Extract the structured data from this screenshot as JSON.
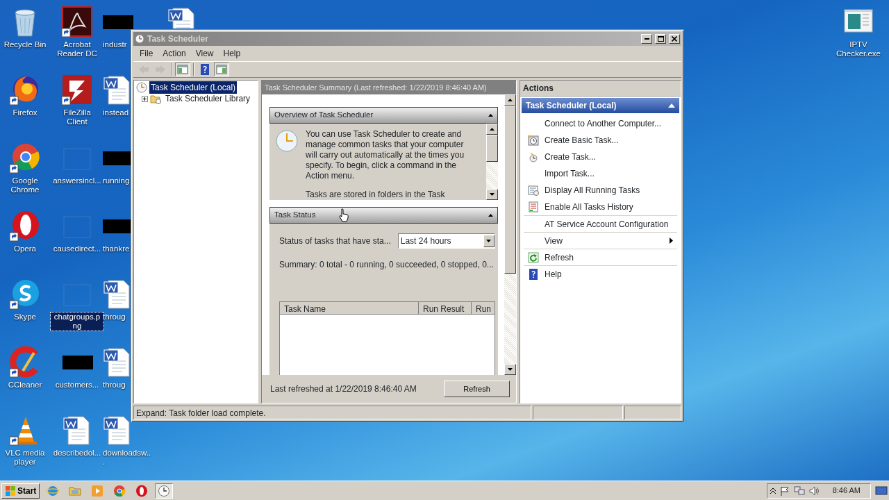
{
  "desktop_icons": [
    {
      "label": "Recycle Bin",
      "kind": "recycle",
      "shortcut": false,
      "selected": false
    },
    {
      "label": "Firefox",
      "kind": "firefox",
      "shortcut": true,
      "selected": false
    },
    {
      "label": "Google Chrome",
      "kind": "chrome",
      "shortcut": true,
      "selected": false
    },
    {
      "label": "Opera",
      "kind": "opera",
      "shortcut": true,
      "selected": false
    },
    {
      "label": "Skype",
      "kind": "skype",
      "shortcut": true,
      "selected": false
    },
    {
      "label": "CCleaner",
      "kind": "ccleaner",
      "shortcut": true,
      "selected": false
    },
    {
      "label": "VLC media player",
      "kind": "vlc",
      "shortcut": true,
      "selected": false
    },
    {
      "label": "Acrobat Reader DC",
      "kind": "acrobat",
      "shortcut": true,
      "selected": false
    },
    {
      "label": "FileZilla Client",
      "kind": "filezilla",
      "shortcut": true,
      "selected": false
    },
    {
      "label": "answersincl...",
      "kind": "blank",
      "shortcut": false,
      "selected": false
    },
    {
      "label": "causedirect...",
      "kind": "blank",
      "shortcut": false,
      "selected": false
    },
    {
      "label": "chatgroups.png",
      "kind": "blank",
      "shortcut": false,
      "selected": true
    },
    {
      "label": "customers...",
      "kind": "redacted",
      "shortcut": false,
      "selected": false
    },
    {
      "label": "describedol...",
      "kind": "word",
      "shortcut": false,
      "selected": false
    },
    {
      "label": "industr",
      "kind": "redacted",
      "shortcut": false,
      "selected": false
    },
    {
      "label": "instead",
      "kind": "word",
      "shortcut": false,
      "selected": false
    },
    {
      "label": "running",
      "kind": "redacted",
      "shortcut": false,
      "selected": false
    },
    {
      "label": "thankre",
      "kind": "redacted",
      "shortcut": false,
      "selected": false
    },
    {
      "label": "throug",
      "kind": "word",
      "shortcut": false,
      "selected": false
    },
    {
      "label": "throug",
      "kind": "word",
      "shortcut": false,
      "selected": false
    },
    {
      "label": "downloadsw...",
      "kind": "word",
      "shortcut": false,
      "selected": false
    },
    {
      "kind": "word",
      "shortcut": false
    }
  ],
  "desktop_icons_right": [
    {
      "label": "IPTV Checker.exe",
      "kind": "exe",
      "shortcut": false,
      "selected": false
    }
  ],
  "window": {
    "title": "Task Scheduler",
    "active": false
  },
  "menu": [
    "File",
    "Action",
    "View",
    "Help"
  ],
  "toolbar": [
    {
      "kind": "back",
      "disabled": true,
      "pressed": false
    },
    {
      "kind": "forward",
      "disabled": true,
      "pressed": false
    },
    {
      "kind": "console-tree",
      "disabled": false,
      "pressed": true
    },
    {
      "kind": "help",
      "disabled": false,
      "pressed": false
    },
    {
      "kind": "action-pane",
      "disabled": false,
      "pressed": true
    }
  ],
  "tree": [
    {
      "label": "Task Scheduler (Local)",
      "selected": true,
      "children": [
        {
          "label": "Task Scheduler Library",
          "selected": false,
          "expanded": false
        }
      ]
    }
  ],
  "summary": {
    "title": "Task Scheduler Summary (Last refreshed: 1/22/2019 8:46:40 AM)",
    "overview": {
      "title": "Overview of Task Scheduler",
      "expanded": true,
      "paragraphs": [
        "You can use Task Scheduler to create and manage common tasks that your computer will carry out automatically at the times you specify. To begin, click a command in the Action menu.",
        "Tasks are stored in folders in the Task"
      ]
    },
    "status": {
      "title": "Task Status",
      "expanded": true,
      "filter_label": "Status of tasks that have sta...",
      "filter_value": "Last 24 hours",
      "summary": "Summary: 0 total - 0 running, 0 succeeded, 0 stopped, 0...",
      "columns": [
        "Task Name",
        "Run Result",
        "Run"
      ]
    },
    "last_refreshed": "Last refreshed at 1/22/2019 8:46:40 AM",
    "refresh_button": "Refresh"
  },
  "actions": {
    "title": "Actions",
    "group": {
      "title": "Task Scheduler (Local)",
      "expanded": true
    },
    "items": [
      {
        "label": "Connect to Another Computer...",
        "kind": "none",
        "submenu": false,
        "separated": false
      },
      {
        "label": "Create Basic Task...",
        "kind": "basic-task",
        "submenu": false,
        "separated": false
      },
      {
        "label": "Create Task...",
        "kind": "task",
        "submenu": false,
        "separated": false
      },
      {
        "label": "Import Task...",
        "kind": "none",
        "submenu": false,
        "separated": false
      },
      {
        "label": "Display All Running Tasks",
        "kind": "running",
        "submenu": false,
        "separated": false
      },
      {
        "label": "Enable All Tasks History",
        "kind": "history",
        "submenu": false,
        "separated": false
      },
      {
        "label": "AT Service Account Configuration",
        "kind": "none",
        "submenu": false,
        "separated": true
      },
      {
        "label": "View",
        "kind": "none",
        "submenu": true,
        "separated": true
      },
      {
        "label": "Refresh",
        "kind": "refresh",
        "submenu": false,
        "separated": true
      },
      {
        "label": "Help",
        "kind": "help",
        "submenu": false,
        "separated": true
      }
    ]
  },
  "status_bar": "Expand:  Task folder load complete.",
  "taskbar": {
    "start": "Start",
    "apps": [
      {
        "kind": "ie",
        "active": false
      },
      {
        "kind": "folder",
        "active": false
      },
      {
        "kind": "media",
        "active": false
      },
      {
        "kind": "chrome",
        "active": false
      },
      {
        "kind": "opera",
        "active": false
      },
      {
        "kind": "clock",
        "active": true
      }
    ],
    "clock": "8:46 AM"
  }
}
